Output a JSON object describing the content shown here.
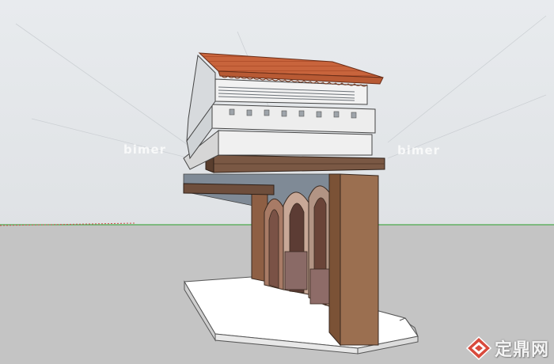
{
  "watermarks": {
    "left": "bimer",
    "right": "bimer"
  },
  "brand": {
    "text": "定鼎网",
    "logo_icon": "diamond-logo-icon"
  },
  "colors": {
    "sky": "#e6e9ec",
    "ground": "#c4c4c4",
    "roof_tile": "#c8643c",
    "stucco": "#ececec",
    "wood_beam": "#6e4e3c",
    "pillar": "#9b6f50",
    "arch_stone": "#b09080",
    "horizon_line": "#4caa4c"
  }
}
